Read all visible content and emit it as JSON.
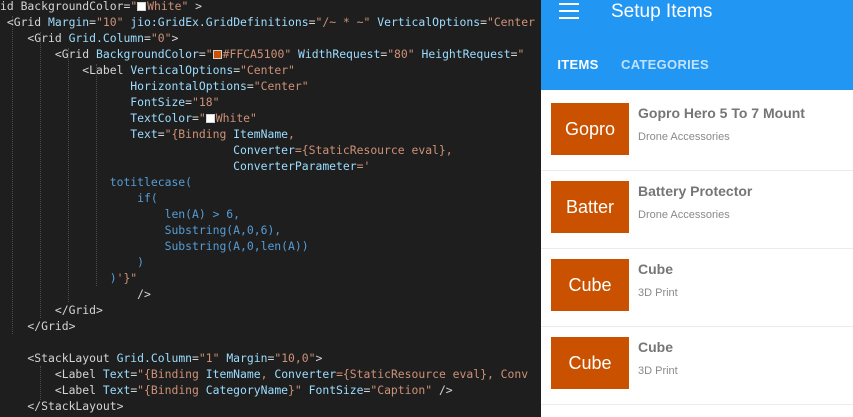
{
  "editor": {
    "lines": [
      [
        {
          "c": "t-tag",
          "t": "id BackgroundColor="
        },
        {
          "c": "t-str",
          "t": "\""
        },
        {
          "c": "t-str",
          "t": "White",
          "swatch": "#ffffff"
        },
        {
          "c": "t-str",
          "t": "\""
        },
        {
          "c": "t-tag",
          "t": " >"
        }
      ],
      [
        {
          "c": "t-tag",
          "t": " <Grid "
        },
        {
          "c": "t-attr",
          "t": "Margin"
        },
        {
          "c": "t-tag",
          "t": "="
        },
        {
          "c": "t-str",
          "t": "\"10\""
        },
        {
          "c": "t-attr",
          "t": " jio:GridEx.GridDefinitions"
        },
        {
          "c": "t-tag",
          "t": "="
        },
        {
          "c": "t-str",
          "t": "\"/~ * ~\""
        },
        {
          "c": "t-attr",
          "t": " VerticalOptions"
        },
        {
          "c": "t-tag",
          "t": "="
        },
        {
          "c": "t-str",
          "t": "\"Center"
        }
      ],
      [
        {
          "c": "t-tag",
          "t": "    <Grid "
        },
        {
          "c": "t-attr",
          "t": "Grid.Column"
        },
        {
          "c": "t-tag",
          "t": "="
        },
        {
          "c": "t-str",
          "t": "\"0\""
        },
        {
          "c": "t-tag",
          "t": ">"
        }
      ],
      [
        {
          "c": "t-tag",
          "t": "        <Grid "
        },
        {
          "c": "t-attr",
          "t": "BackgroundColor"
        },
        {
          "c": "t-tag",
          "t": "="
        },
        {
          "c": "t-str",
          "t": "\""
        },
        {
          "c": "t-str",
          "t": "#FFCA5100\"",
          "swatch": "#ca5100"
        },
        {
          "c": "t-attr",
          "t": " WidthRequest"
        },
        {
          "c": "t-tag",
          "t": "="
        },
        {
          "c": "t-str",
          "t": "\"80\""
        },
        {
          "c": "t-attr",
          "t": " HeightRequest"
        },
        {
          "c": "t-tag",
          "t": "="
        },
        {
          "c": "t-str",
          "t": "\""
        }
      ],
      [
        {
          "c": "t-tag",
          "t": "            <Label "
        },
        {
          "c": "t-attr",
          "t": "VerticalOptions"
        },
        {
          "c": "t-tag",
          "t": "="
        },
        {
          "c": "t-str",
          "t": "\"Center\""
        }
      ],
      [
        {
          "c": "t-attr",
          "t": "                   HorizontalOptions"
        },
        {
          "c": "t-tag",
          "t": "="
        },
        {
          "c": "t-str",
          "t": "\"Center\""
        }
      ],
      [
        {
          "c": "t-attr",
          "t": "                   FontSize"
        },
        {
          "c": "t-tag",
          "t": "="
        },
        {
          "c": "t-str",
          "t": "\"18\""
        }
      ],
      [
        {
          "c": "t-attr",
          "t": "                   TextColor"
        },
        {
          "c": "t-tag",
          "t": "="
        },
        {
          "c": "t-str",
          "t": "\""
        },
        {
          "c": "t-str",
          "t": "White\"",
          "swatch": "#ffffff"
        }
      ],
      [
        {
          "c": "t-attr",
          "t": "                   Text"
        },
        {
          "c": "t-tag",
          "t": "="
        },
        {
          "c": "t-str",
          "t": "\"{Binding "
        },
        {
          "c": "t-attr",
          "t": "ItemName"
        },
        {
          "c": "t-str",
          "t": ","
        }
      ],
      [
        {
          "c": "t-attr",
          "t": "                                  Converter"
        },
        {
          "c": "t-str",
          "t": "={StaticResource eval},"
        }
      ],
      [
        {
          "c": "t-attr",
          "t": "                                  ConverterParameter"
        },
        {
          "c": "t-str",
          "t": "='"
        }
      ],
      [
        {
          "c": "t-expr",
          "t": "                totitlecase("
        }
      ],
      [
        {
          "c": "t-expr",
          "t": "                    if("
        }
      ],
      [
        {
          "c": "t-expr",
          "t": "                        len(A) > 6,"
        }
      ],
      [
        {
          "c": "t-expr",
          "t": "                        Substring(A,0,6),"
        }
      ],
      [
        {
          "c": "t-expr",
          "t": "                        Substring(A,0,len(A))"
        }
      ],
      [
        {
          "c": "t-expr",
          "t": "                    )"
        }
      ],
      [
        {
          "c": "t-expr",
          "t": "                )"
        },
        {
          "c": "t-str",
          "t": "'}\""
        }
      ],
      [
        {
          "c": "t-tag",
          "t": "                    />"
        }
      ],
      [
        {
          "c": "t-tag",
          "t": "        </Grid>"
        }
      ],
      [
        {
          "c": "t-tag",
          "t": "    </Grid>"
        }
      ],
      [
        {
          "c": "t-tag",
          "t": ""
        }
      ],
      [
        {
          "c": "t-tag",
          "t": "    <StackLayout "
        },
        {
          "c": "t-attr",
          "t": "Grid.Column"
        },
        {
          "c": "t-tag",
          "t": "="
        },
        {
          "c": "t-str",
          "t": "\"1\""
        },
        {
          "c": "t-attr",
          "t": " Margin"
        },
        {
          "c": "t-tag",
          "t": "="
        },
        {
          "c": "t-str",
          "t": "\"10,0\""
        },
        {
          "c": "t-tag",
          "t": ">"
        }
      ],
      [
        {
          "c": "t-tag",
          "t": "        <Label "
        },
        {
          "c": "t-attr",
          "t": "Text"
        },
        {
          "c": "t-tag",
          "t": "="
        },
        {
          "c": "t-str",
          "t": "\"{Binding "
        },
        {
          "c": "t-attr",
          "t": "ItemName"
        },
        {
          "c": "t-str",
          "t": ", "
        },
        {
          "c": "t-attr",
          "t": "Converter"
        },
        {
          "c": "t-str",
          "t": "={StaticResource eval}, Conv"
        }
      ],
      [
        {
          "c": "t-tag",
          "t": "        <Label "
        },
        {
          "c": "t-attr",
          "t": "Text"
        },
        {
          "c": "t-tag",
          "t": "="
        },
        {
          "c": "t-str",
          "t": "\"{Binding "
        },
        {
          "c": "t-attr",
          "t": "CategoryName"
        },
        {
          "c": "t-str",
          "t": "}\""
        },
        {
          "c": "t-attr",
          "t": " FontSize"
        },
        {
          "c": "t-tag",
          "t": "="
        },
        {
          "c": "t-str",
          "t": "\"Caption\""
        },
        {
          "c": "t-tag",
          "t": " />"
        }
      ],
      [
        {
          "c": "t-tag",
          "t": "    </StackLayout>"
        }
      ]
    ]
  },
  "app": {
    "title": "Setup Items",
    "menu_icon": "hamburger-menu-icon",
    "accent_color": "#2196f3",
    "tile_color": "#ca5100",
    "tabs": [
      {
        "label": "ITEMS",
        "selected": true
      },
      {
        "label": "CATEGORIES",
        "selected": false
      }
    ],
    "items": [
      {
        "thumb": "Gopro",
        "name": "Gopro Hero 5 To 7 Mount",
        "category": "Drone Accessories"
      },
      {
        "thumb": "Batter",
        "name": "Battery Protector",
        "category": "Drone Accessories"
      },
      {
        "thumb": "Cube",
        "name": "Cube",
        "category": "3D Print"
      },
      {
        "thumb": "Cube",
        "name": "Cube",
        "category": "3D Print"
      }
    ]
  }
}
